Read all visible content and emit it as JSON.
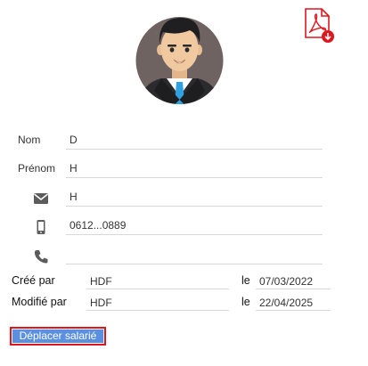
{
  "form": {
    "nom": {
      "label": "Nom",
      "value": "D"
    },
    "prenom": {
      "label": "Prénom",
      "value": "H"
    },
    "email": {
      "icon": "envelope-icon",
      "value": "H"
    },
    "mobile": {
      "icon": "mobile-phone-icon",
      "value": "0612...0889"
    },
    "phone": {
      "icon": "phone-icon",
      "value": ""
    }
  },
  "meta": {
    "created_by_label": "Créé par",
    "created_by": "HDF",
    "created_on_label": "le",
    "created_on": "07/03/2022",
    "modified_by_label": "Modifié par",
    "modified_by": "HDF",
    "modified_on_label": "le",
    "modified_on": "22/04/2025"
  },
  "actions": {
    "move_employee_label": "Déplacer salarié",
    "pdf_icon": "pdf-download-icon"
  },
  "colors": {
    "accent_red": "#e0161d",
    "button_blue": "#5b8fe0"
  }
}
